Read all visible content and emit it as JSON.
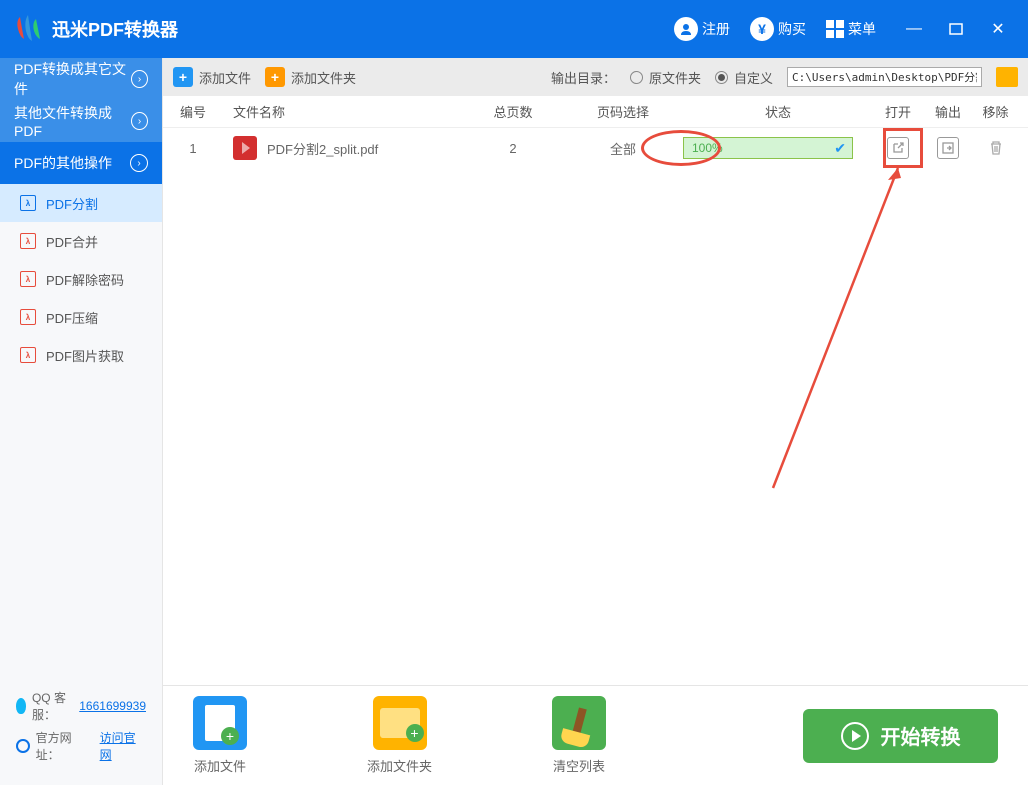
{
  "app": {
    "title": "迅米PDF转换器"
  },
  "titlebar": {
    "register": "注册",
    "buy": "购买",
    "menu": "菜单"
  },
  "sidebar": {
    "categories": [
      {
        "label": "PDF转换成其它文件"
      },
      {
        "label": "其他文件转换成PDF"
      },
      {
        "label": "PDF的其他操作"
      }
    ],
    "items": [
      {
        "label": "PDF分割"
      },
      {
        "label": "PDF合并"
      },
      {
        "label": "PDF解除密码"
      },
      {
        "label": "PDF压缩"
      },
      {
        "label": "PDF图片获取"
      }
    ],
    "footer": {
      "qq_label": "QQ 客服：",
      "qq_value": "1661699939",
      "site_label": "官方网址：",
      "site_link": "访问官网"
    }
  },
  "toolbar": {
    "add_file": "添加文件",
    "add_folder": "添加文件夹",
    "output_label": "输出目录：",
    "opt_original": "原文件夹",
    "opt_custom": "自定义",
    "path": "C:\\Users\\admin\\Desktop\\PDF分割"
  },
  "table": {
    "headers": {
      "num": "编号",
      "name": "文件名称",
      "pages": "总页数",
      "select": "页码选择",
      "status": "状态",
      "open": "打开",
      "output": "输出",
      "remove": "移除"
    },
    "rows": [
      {
        "num": "1",
        "name": "PDF分割2_split.pdf",
        "pages": "2",
        "select": "全部",
        "progress": "100%"
      }
    ]
  },
  "bottom": {
    "add_file": "添加文件",
    "add_folder": "添加文件夹",
    "clear": "清空列表",
    "start": "开始转换"
  }
}
